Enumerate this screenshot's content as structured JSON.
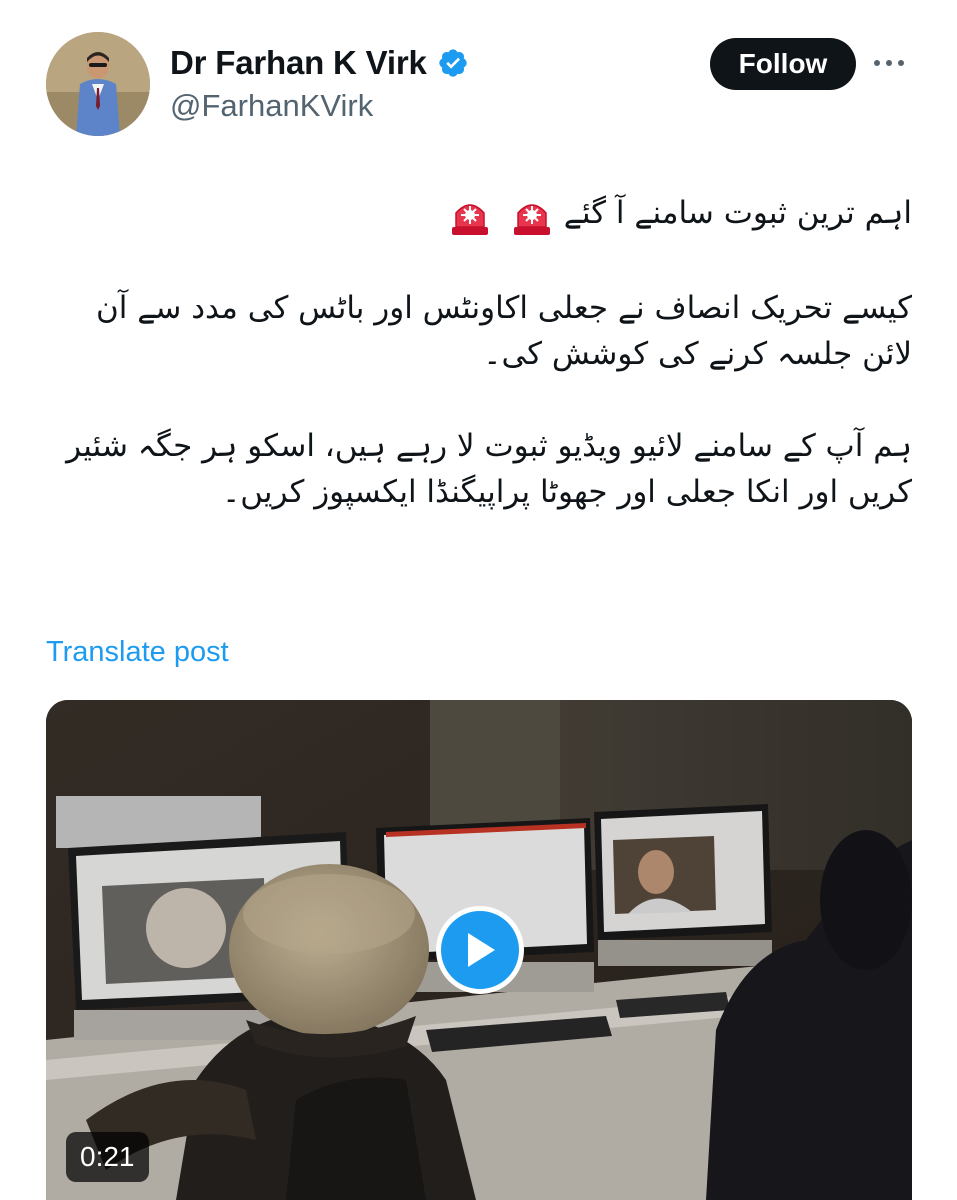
{
  "author": {
    "display_name": "Dr Farhan K Virk",
    "handle": "@FarhanKVirk",
    "verified_icon": "verified-badge-icon",
    "avatar": "profile-photo"
  },
  "actions": {
    "follow_label": "Follow",
    "more_icon": "more-options-icon"
  },
  "post": {
    "headline": "اہم ترین ثبوت سامنے آ گئے",
    "headline_icons": [
      "rotating-light-icon",
      "rotating-light-icon"
    ],
    "paragraph_2": "کیسے تحریک انصاف نے جعلی اکاونٹس اور باٹس کی مدد سے آن لائن جلسہ کرنے کی کوشش کی۔",
    "paragraph_3": "ہم آپ کے سامنے لائیو ویڈیو ثبوت لا رہے ہیں، اسکو ہر جگہ شئیر کریں اور انکا جعلی اور جھوٹا پراپیگنڈا ایکسپوز کریں۔",
    "translate_label": "Translate post"
  },
  "media": {
    "type": "video",
    "duration": "0:21",
    "play_icon": "play-icon"
  },
  "colors": {
    "accent": "#1d9bf0",
    "text_primary": "#0f1419",
    "text_secondary": "#536471",
    "follow_bg": "#0f1419"
  }
}
